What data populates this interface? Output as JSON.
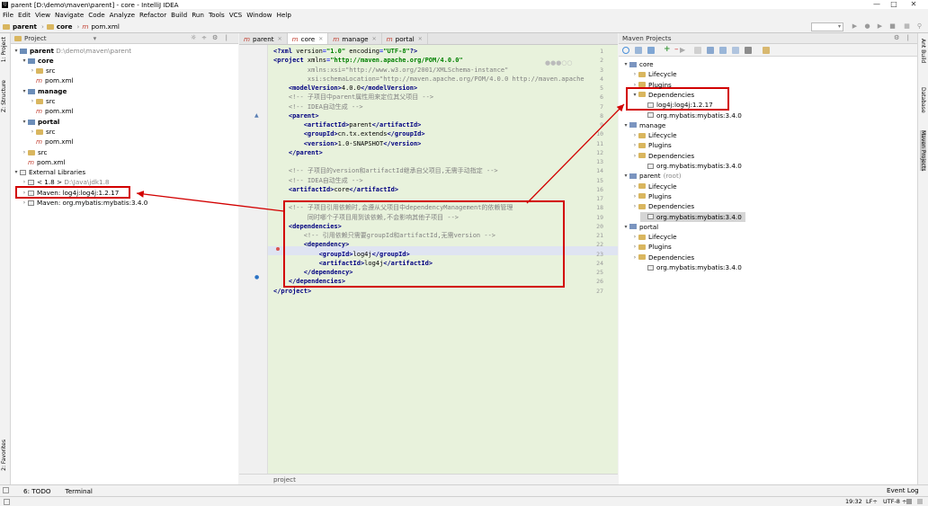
{
  "window": {
    "title": "parent [D:\\demo\\maven\\parent] - core - IntelliJ IDEA",
    "controls": [
      "minimize-icon",
      "maximize-icon",
      "close-icon"
    ]
  },
  "menu": [
    "File",
    "Edit",
    "View",
    "Navigate",
    "Code",
    "Analyze",
    "Refactor",
    "Build",
    "Run",
    "Tools",
    "VCS",
    "Window",
    "Help"
  ],
  "breadcrumb": [
    "parent",
    "core",
    "pom.xml"
  ],
  "left_strip": [
    "1: Project",
    "Z: Structure",
    "2: Favorites"
  ],
  "project": {
    "header": "Project",
    "tree": [
      {
        "label": "parent",
        "path": "D:\\demo\\maven\\parent",
        "kind": "module",
        "expanded": true
      },
      {
        "label": "core",
        "kind": "module",
        "expanded": true
      },
      {
        "label": "src",
        "kind": "folder"
      },
      {
        "label": "pom.xml",
        "kind": "xml"
      },
      {
        "label": "manage",
        "kind": "module",
        "expanded": true
      },
      {
        "label": "src",
        "kind": "folder"
      },
      {
        "label": "pom.xml",
        "kind": "xml"
      },
      {
        "label": "portal",
        "kind": "module",
        "expanded": true
      },
      {
        "label": "src",
        "kind": "folder"
      },
      {
        "label": "pom.xml",
        "kind": "xml"
      },
      {
        "label": "src",
        "kind": "folder"
      },
      {
        "label": "pom.xml",
        "kind": "xml"
      },
      {
        "label": "External Libraries",
        "kind": "library",
        "expanded": true
      },
      {
        "label": "< 1.8 >",
        "path": "D:\\Java\\jdk1.8",
        "kind": "jdk"
      },
      {
        "label": "Maven: log4j:log4j:1.2.17",
        "kind": "library",
        "highlighted": true
      },
      {
        "label": "Maven: org.mybatis:mybatis:3.4.0",
        "kind": "library"
      }
    ]
  },
  "tabs": [
    {
      "label": "parent",
      "active": false
    },
    {
      "label": "core",
      "active": true
    },
    {
      "label": "manage",
      "active": false
    },
    {
      "label": "portal",
      "active": false
    }
  ],
  "editor": {
    "line_numbers": [
      "1",
      "2",
      "3",
      "4",
      "5",
      "6",
      "7",
      "8",
      "9",
      "10",
      "11",
      "12",
      "13",
      "14",
      "15",
      "16",
      "17",
      "18",
      "19",
      "20",
      "21",
      "22",
      "23",
      "24",
      "25",
      "26",
      "27"
    ],
    "lines": [
      "<?xml version=\"1.0\" encoding=\"UTF-8\"?>",
      "<project xmlns=\"http://maven.apache.org/POM/4.0.0\"",
      "         xmlns:xsi=\"http://www.w3.org/2001/XMLSchema-instance\"",
      "         xsi:schemaLocation=\"http://maven.apache.org/POM/4.0.0 http://maven.apache",
      "    <modelVersion>4.0.0</modelVersion>",
      "    <!-- 子项目中parent属性用来定位其父项目 -->",
      "    <!-- IDEA自动生成 -->",
      "    <parent>",
      "        <artifactId>parent</artifactId>",
      "        <groupId>cn.tx.extends</groupId>",
      "        <version>1.0-SNAPSHOT</version>",
      "    </parent>",
      "",
      "    <!-- 子项目的version和artifactId继承自父项目,无需手动指定 -->",
      "    <!-- IDEA自动生成 -->",
      "    <artifactId>core</artifactId>",
      "",
      "    <!-- 子项目引用依赖时,会遵从父项目中dependencyManagement的依赖管理",
      "         同时哪个子项目用到该依赖,不会影响其他子项目 -->",
      "    <dependencies>",
      "        <!-- 引用依赖只需要groupId和artifactId,无需version -->",
      "        <dependency>",
      "            <groupId>log4j</groupId>",
      "            <artifactId>log4j</artifactId>",
      "        </dependency>",
      "    </dependencies>",
      "</project>"
    ],
    "status_path": "project"
  },
  "maven": {
    "header": "Maven Projects",
    "tree": [
      {
        "label": "core",
        "depth": 0
      },
      {
        "label": "Lifecycle",
        "depth": 1
      },
      {
        "label": "Plugins",
        "depth": 1
      },
      {
        "label": "Dependencies",
        "depth": 1,
        "expanded": true,
        "highlighted": true
      },
      {
        "label": "log4j:log4j:1.2.17",
        "depth": 2,
        "highlighted": true
      },
      {
        "label": "org.mybatis:mybatis:3.4.0",
        "depth": 2
      },
      {
        "label": "manage",
        "depth": 0
      },
      {
        "label": "Lifecycle",
        "depth": 1
      },
      {
        "label": "Plugins",
        "depth": 1
      },
      {
        "label": "Dependencies",
        "depth": 1
      },
      {
        "label": "org.mybatis:mybatis:3.4.0",
        "depth": 2
      },
      {
        "label": "parent",
        "suffix": "(root)",
        "depth": 0
      },
      {
        "label": "Lifecycle",
        "depth": 1
      },
      {
        "label": "Plugins",
        "depth": 1
      },
      {
        "label": "Dependencies",
        "depth": 1
      },
      {
        "label": "org.mybatis:mybatis:3.4.0",
        "depth": 2,
        "selected": true
      },
      {
        "label": "portal",
        "depth": 0
      },
      {
        "label": "Lifecycle",
        "depth": 1
      },
      {
        "label": "Plugins",
        "depth": 1
      },
      {
        "label": "Dependencies",
        "depth": 1
      },
      {
        "label": "org.mybatis:mybatis:3.4.0",
        "depth": 2
      }
    ]
  },
  "right_strip": [
    "Ant Build",
    "Database",
    "Maven Projects"
  ],
  "bottom": {
    "todo": "6: TODO",
    "terminal": "Terminal",
    "event_log": "Event Log"
  },
  "status": {
    "position": "19:32",
    "line_sep": "LF÷",
    "encoding": "UTF-8 ÷"
  },
  "annotation_color": "#d20000"
}
